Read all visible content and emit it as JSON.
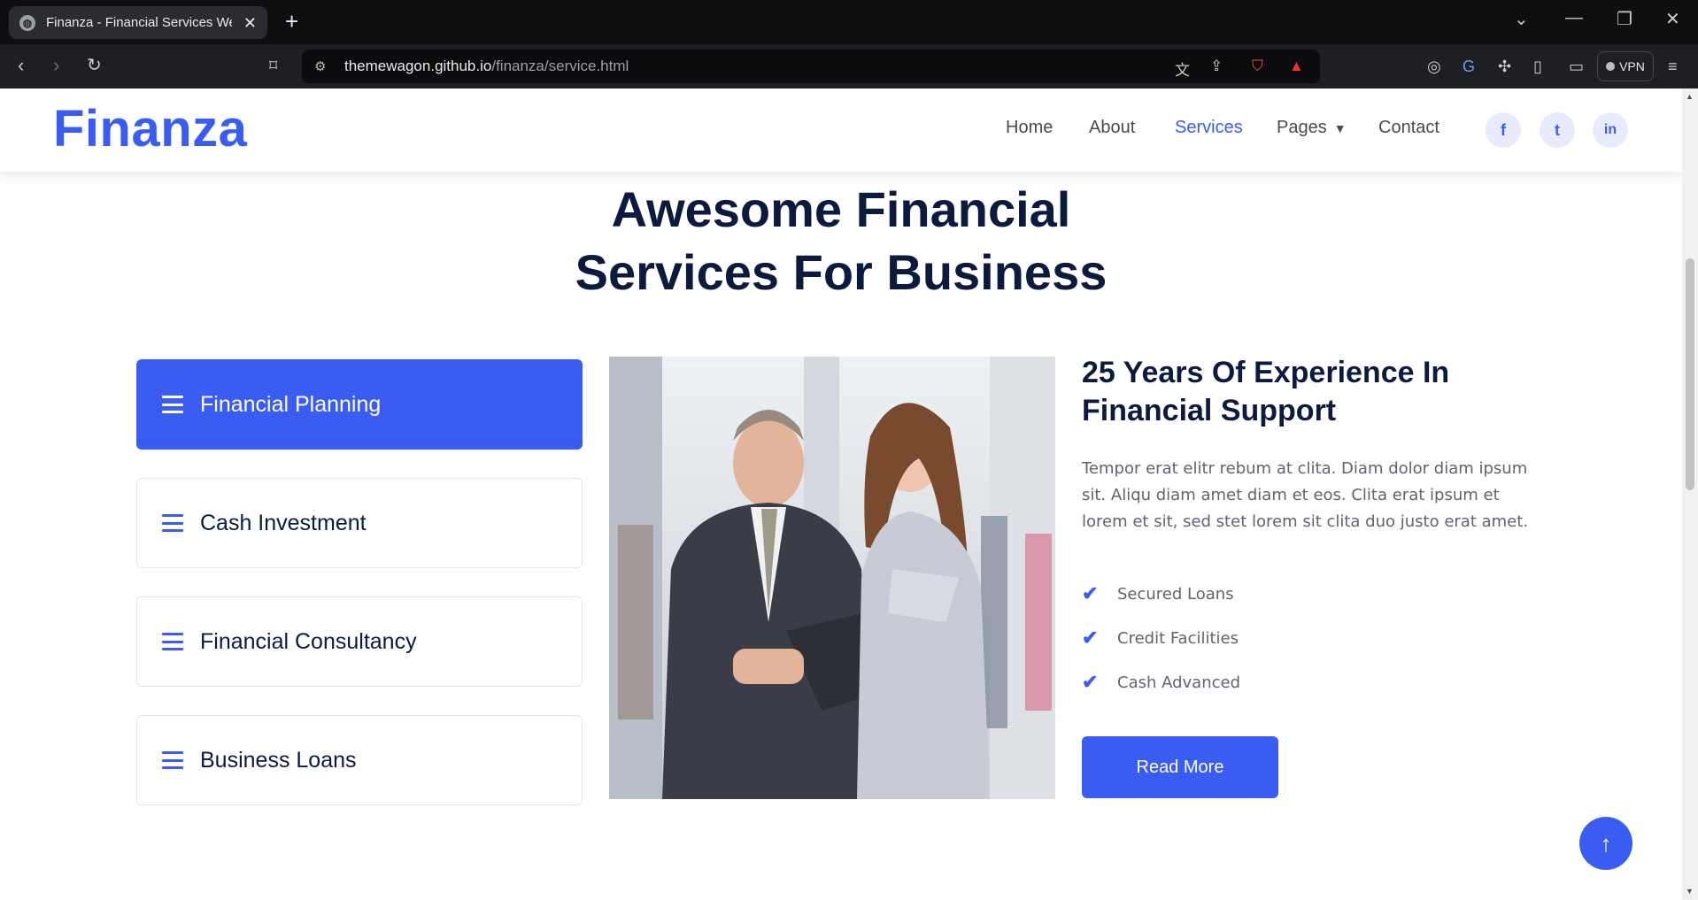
{
  "browser": {
    "tab_title": "Finanza - Financial Services Web",
    "url_host": "themewagon.github.io",
    "url_path": "/finanza/service.html",
    "vpn_label": "VPN"
  },
  "nav": {
    "brand": "Finanza",
    "items": [
      {
        "label": "Home"
      },
      {
        "label": "About"
      },
      {
        "label": "Services"
      },
      {
        "label": "Pages"
      },
      {
        "label": "Contact"
      }
    ],
    "social": [
      {
        "label": "f",
        "icon": "facebook-icon"
      },
      {
        "label": "t",
        "icon": "twitter-icon"
      },
      {
        "label": "in",
        "icon": "linkedin-icon"
      }
    ]
  },
  "section": {
    "title_line1": "Awesome Financial",
    "title_line2": "Services For Business"
  },
  "services": [
    {
      "label": "Financial Planning",
      "active": true
    },
    {
      "label": "Cash Investment",
      "active": false
    },
    {
      "label": "Financial Consultancy",
      "active": false
    },
    {
      "label": "Business Loans",
      "active": false
    }
  ],
  "detail": {
    "title_line1": "25 Years Of Experience In",
    "title_line2": "Financial Support",
    "paragraph": "Tempor erat elitr rebum at clita. Diam dolor diam ipsum sit. Aliqu diam amet diam et eos. Clita erat ipsum et lorem et sit, sed stet lorem sit clita duo justo erat amet.",
    "checks": [
      "Secured Loans",
      "Credit Facilities",
      "Cash Advanced"
    ],
    "button": "Read More"
  },
  "colors": {
    "accent": "#3b5cf1",
    "heading": "#0c1a3e",
    "body_text": "#5f6470"
  }
}
